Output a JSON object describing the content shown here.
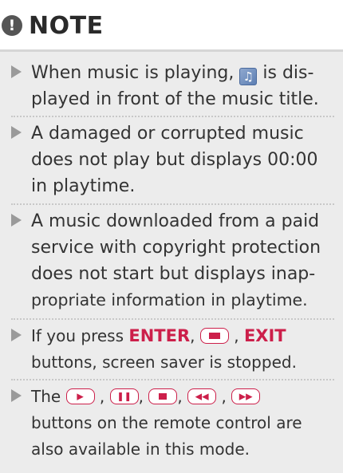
{
  "heading": {
    "icon": "!",
    "title": "NOTE"
  },
  "items": [
    {
      "lines": [
        "When music is playing,",
        "is dis-",
        "played in front of the music title."
      ]
    },
    {
      "lines": [
        "A damaged or corrupted music",
        "does not play but displays 00:00",
        "in playtime."
      ]
    },
    {
      "lines": [
        "A music downloaded from a paid",
        "service with copyright protection",
        "does not start but displays inap-",
        "propriate information in playtime."
      ]
    },
    {
      "parts": {
        "pre": "If you press",
        "enter": "ENTER",
        "comma1": ",",
        "comma2": ",",
        "exit": "EXIT",
        "line2": "buttons, screen saver is  stopped."
      }
    },
    {
      "parts": {
        "pre": "The",
        "c1": ",",
        "c2": ",",
        "c3": ",",
        "c4": ",",
        "line2": "buttons on the remote control are",
        "line3": "also available in this mode."
      }
    }
  ],
  "icons": {
    "note": "exclamation-circle-icon",
    "music": "music-note-icon",
    "bullet": "triangle-bullet-icon",
    "buttons": [
      "stop-button-icon",
      "play-button-icon",
      "pause-button-icon",
      "stop-button-icon",
      "skip-back-button-icon",
      "skip-forward-button-icon"
    ]
  },
  "colors": {
    "accent": "#cc1f4a",
    "panel": "#ececec",
    "text": "#333333"
  }
}
